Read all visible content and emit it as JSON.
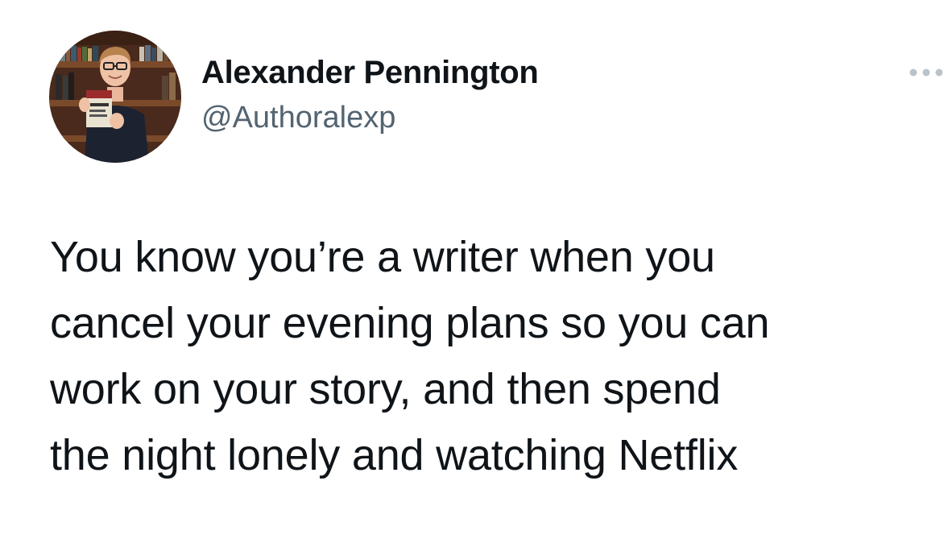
{
  "author": {
    "display_name": "Alexander Pennington",
    "handle": "@Authoralexp",
    "avatar_icon": "profile-photo"
  },
  "tweet": {
    "text": "You know you’re a writer when you\ncancel your evening plans so you can\nwork on your story, and then spend\nthe night lonely and watching Netflix"
  },
  "controls": {
    "more_icon": "more-options-icon"
  },
  "colors": {
    "text": "#0f1419",
    "secondary_text": "#536471",
    "icon": "#b9c3cb",
    "background": "#ffffff"
  }
}
